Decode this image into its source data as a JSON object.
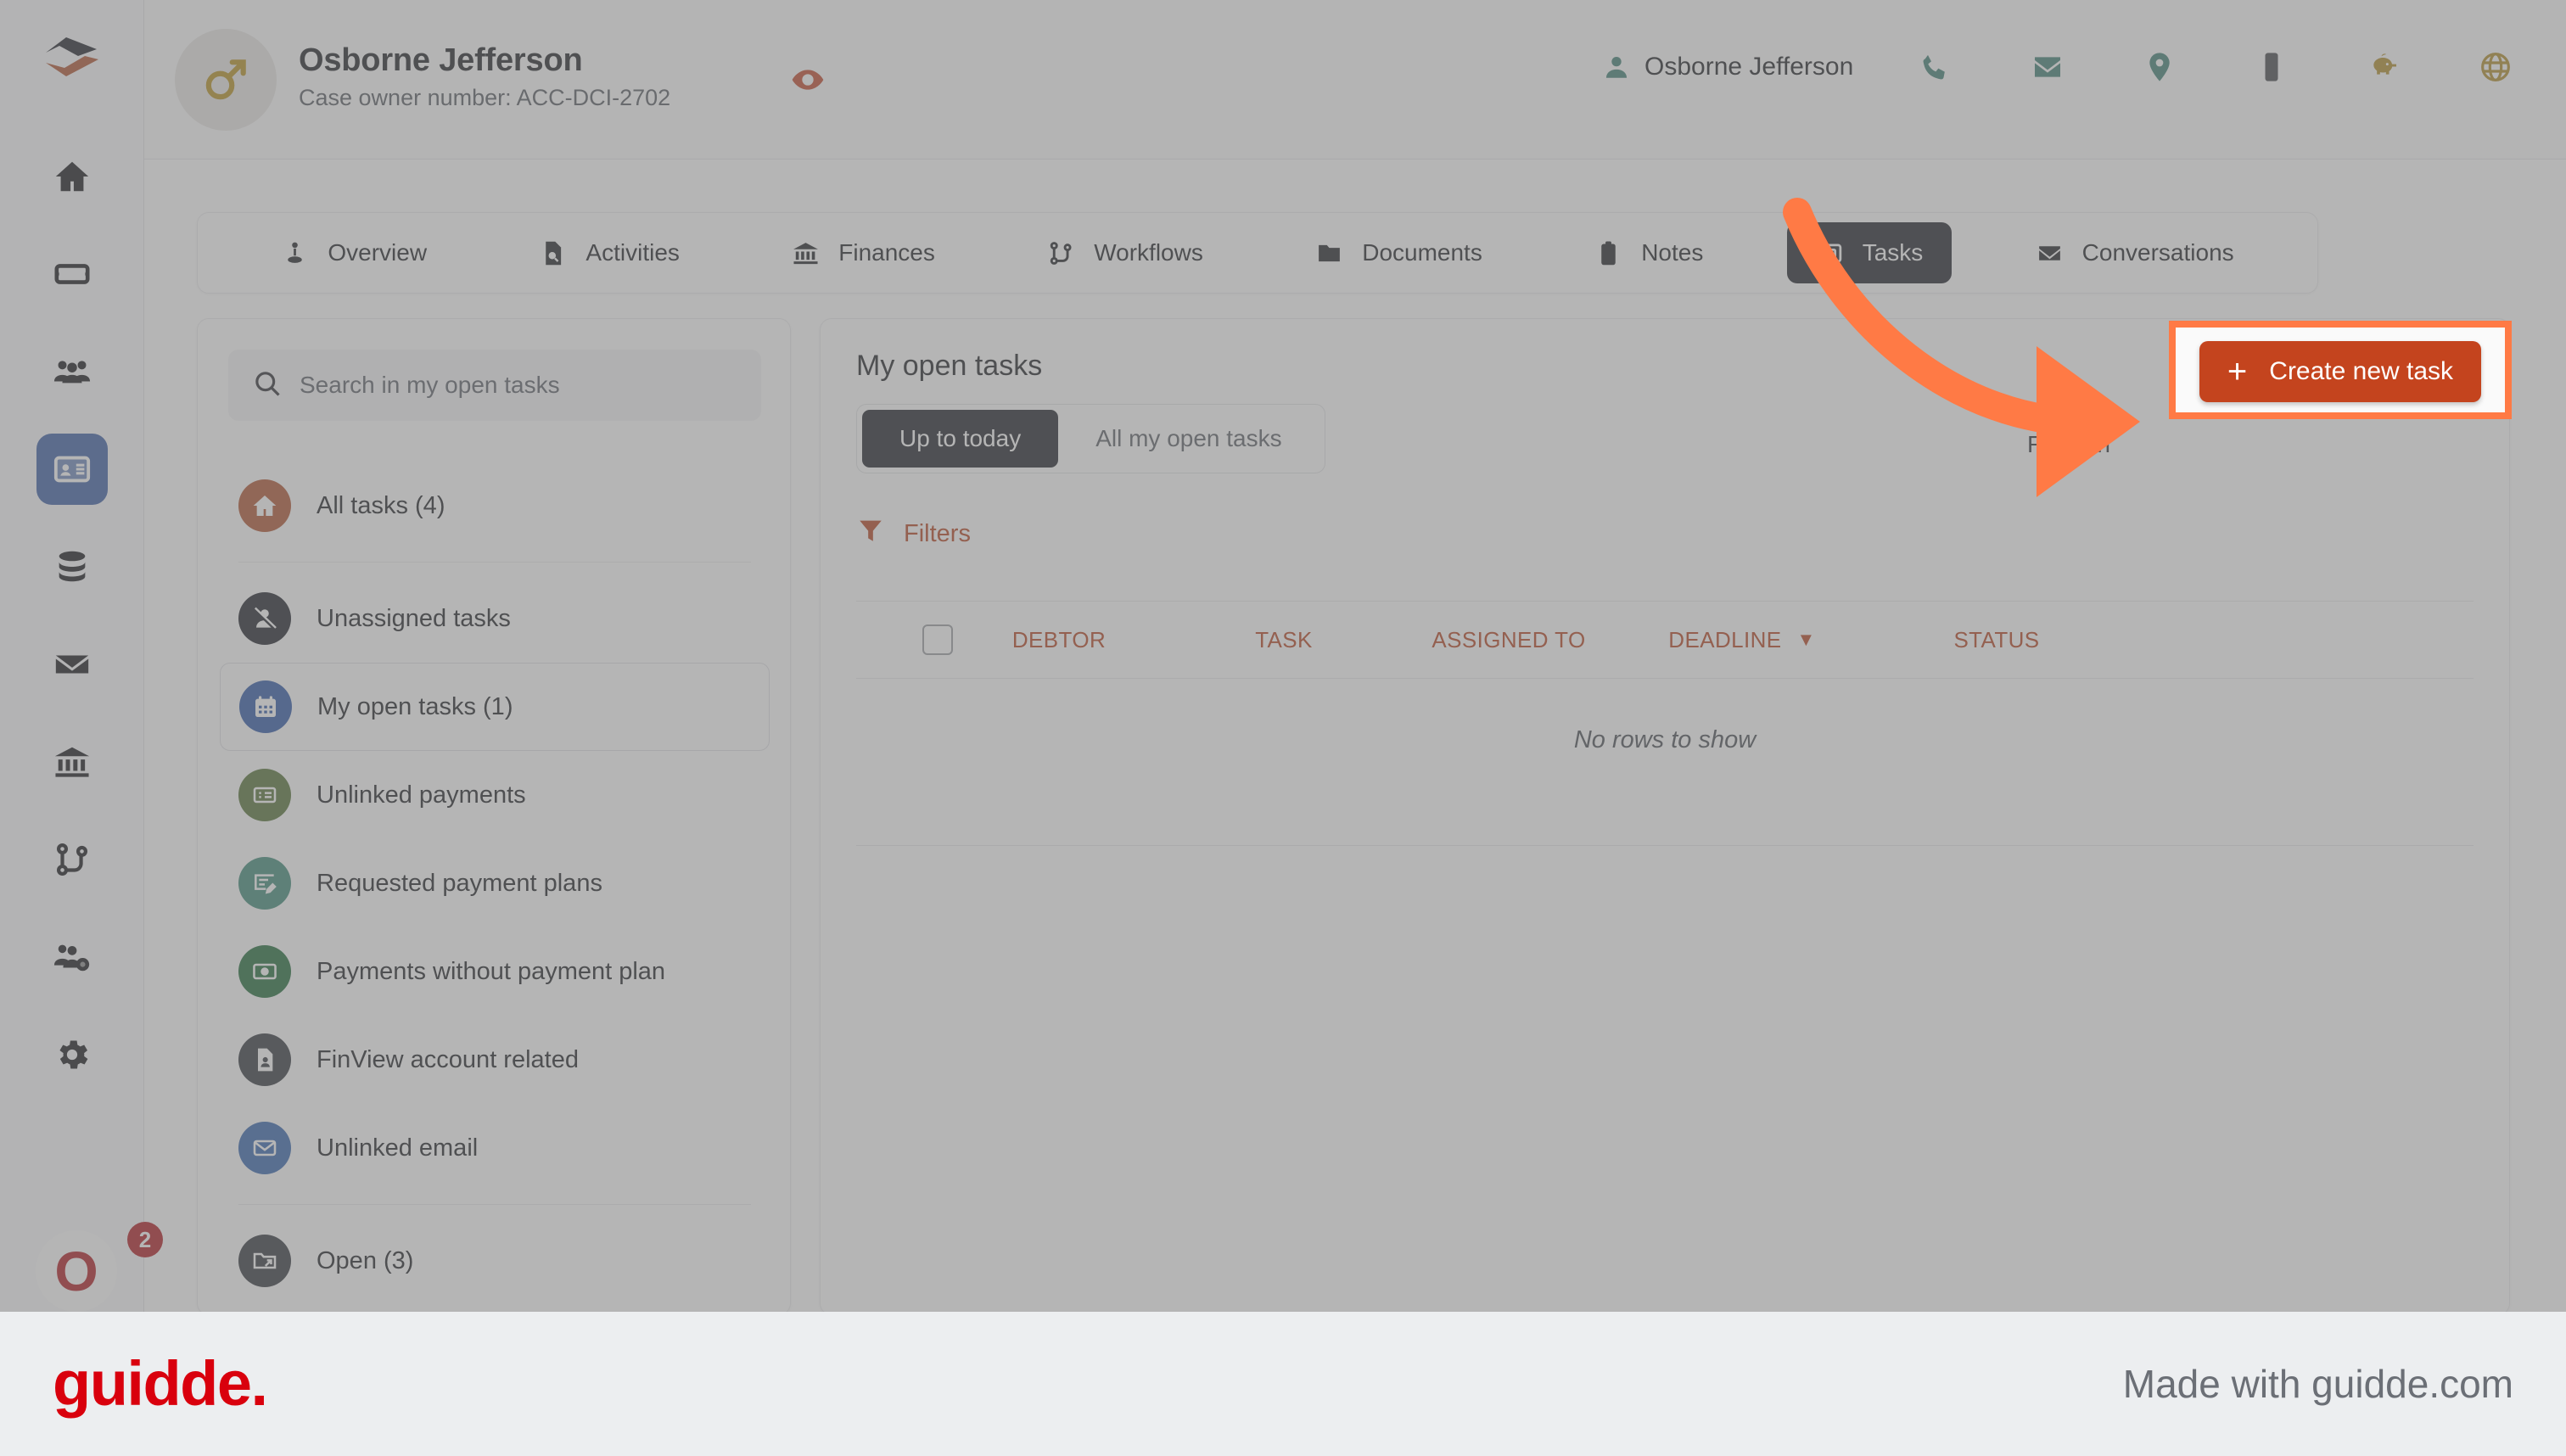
{
  "header": {
    "case_name": "Osborne Jefferson",
    "case_number_label": "Case owner number: ACC-DCI-2702",
    "eye_icon": "eye-icon",
    "user_name": "Osborne Jefferson",
    "user_icon": "person-icon",
    "actions": [
      {
        "name": "phone-icon",
        "color": "#3f7f74"
      },
      {
        "name": "email-icon",
        "color": "#3f7f74"
      },
      {
        "name": "location-pin-icon",
        "color": "#3f7f74"
      },
      {
        "name": "mobile-phone-icon",
        "color": "#43464b"
      },
      {
        "name": "piggy-bank-icon",
        "color": "#b08c28"
      },
      {
        "name": "globe-icon",
        "color": "#b08c28"
      },
      {
        "name": "more-horizontal-icon",
        "color": "#b53b22"
      },
      {
        "name": "chevron-down-icon",
        "color": "#b53b22"
      }
    ]
  },
  "rail": {
    "logo": "company-logo",
    "items": [
      {
        "name": "home-icon",
        "active": false
      },
      {
        "name": "ticket-icon",
        "active": false
      },
      {
        "name": "people-icon",
        "active": false
      },
      {
        "name": "contact-card-icon",
        "active": true
      },
      {
        "name": "database-icon",
        "active": false
      },
      {
        "name": "mail-icon",
        "active": false
      },
      {
        "name": "bank-icon",
        "active": false
      },
      {
        "name": "workflow-icon",
        "active": false
      },
      {
        "name": "team-settings-icon",
        "active": false
      },
      {
        "name": "gear-icon",
        "active": false
      }
    ],
    "avatar_initial": "O",
    "badge_count": "2"
  },
  "tabs": [
    {
      "label": "Overview",
      "icon": "overview-icon",
      "active": false
    },
    {
      "label": "Activities",
      "icon": "activities-icon",
      "active": false
    },
    {
      "label": "Finances",
      "icon": "finances-icon",
      "active": false
    },
    {
      "label": "Workflows",
      "icon": "workflows-icon",
      "active": false
    },
    {
      "label": "Documents",
      "icon": "documents-icon",
      "active": false
    },
    {
      "label": "Notes",
      "icon": "notes-icon",
      "active": false
    },
    {
      "label": "Tasks",
      "icon": "tasks-icon",
      "active": true
    },
    {
      "label": "Conversations",
      "icon": "conversations-icon",
      "active": false
    }
  ],
  "sidebar": {
    "search_placeholder": "Search in my open tasks",
    "search_value": "",
    "search_icon": "search-icon",
    "items": [
      {
        "label": "All tasks (4)",
        "icon": "home-icon",
        "color": "#b0532f",
        "selected": false,
        "divider_after": true
      },
      {
        "label": "Unassigned tasks",
        "icon": "user-slash-icon",
        "color": "#1d2129",
        "selected": false,
        "divider_after": false
      },
      {
        "label": "My open tasks (1)",
        "icon": "calendar-icon",
        "color": "#2e58a6",
        "selected": true,
        "divider_after": false
      },
      {
        "label": "Unlinked payments",
        "icon": "receipt-icon",
        "color": "#547235",
        "selected": false,
        "divider_after": false
      },
      {
        "label": "Requested payment plans",
        "icon": "plan-edit-icon",
        "color": "#3f8a78",
        "selected": false,
        "divider_after": false
      },
      {
        "label": "Payments without payment plan",
        "icon": "banknote-icon",
        "color": "#1f6b39",
        "selected": false,
        "divider_after": false
      },
      {
        "label": "FinView account related",
        "icon": "account-doc-icon",
        "color": "#31353c",
        "selected": false,
        "divider_after": false
      },
      {
        "label": "Unlinked email",
        "icon": "envelope-icon",
        "color": "#3464ad",
        "selected": false,
        "divider_after": true
      },
      {
        "label": "Open (3)",
        "icon": "folder-icon",
        "color": "#31353c",
        "selected": false,
        "divider_after": false
      }
    ]
  },
  "main": {
    "title": "My open tasks",
    "segments": [
      {
        "label": "Up to today",
        "active": true
      },
      {
        "label": "All my open tasks",
        "active": false
      }
    ],
    "refresh_label": "Refresh",
    "filters_label": "Filters",
    "filters_icon": "funnel-icon",
    "table": {
      "columns": [
        "DEBTOR",
        "TASK",
        "ASSIGNED TO",
        "DEADLINE",
        "STATUS"
      ],
      "sort_column": "DEADLINE",
      "sort_caret": "▼",
      "rows": [],
      "empty_message": "No rows to show"
    }
  },
  "callout": {
    "cta_label": "Create new task",
    "cta_plus": "+",
    "arrow_color": "#ff7a45",
    "highlight_color": "#ff7a45"
  },
  "footer": {
    "logo_text": "guidde.",
    "right_text": "Made with guidde.com"
  }
}
